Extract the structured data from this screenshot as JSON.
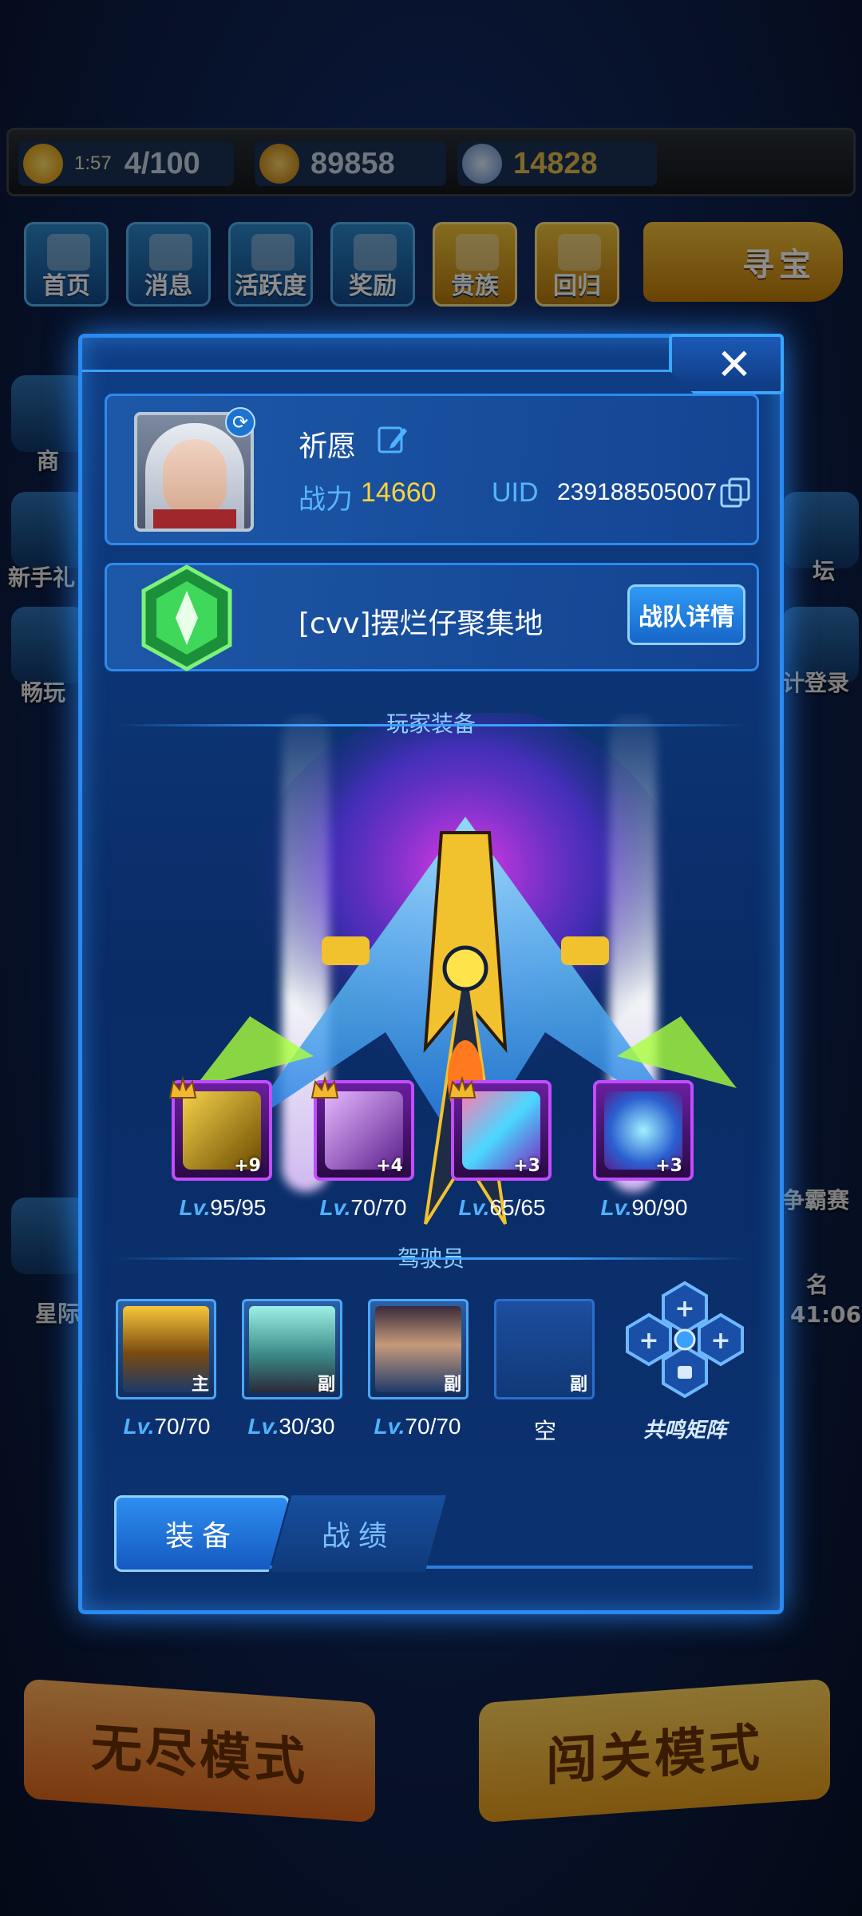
{
  "topbar": {
    "energy_time": "1:57",
    "energy": "4/100",
    "coins": "89858",
    "gems": "14828"
  },
  "nav": {
    "items": [
      "首页",
      "消息",
      "活跃度",
      "奖励",
      "贵族",
      "回归"
    ],
    "treasure": "寻宝"
  },
  "background": {
    "left_labels": [
      "商",
      "新手礼",
      "畅玩",
      "星际"
    ],
    "right_labels": [
      "坛",
      "计登录",
      "争霸赛",
      "名",
      "41:06"
    ],
    "mode_endless": "无尽模式",
    "mode_stage": "闯关模式"
  },
  "modal": {
    "close": "✕",
    "profile": {
      "name": "祈愿",
      "power_label": "战力",
      "power_value": "14660",
      "uid_label": "UID",
      "uid_value": "239188505007"
    },
    "team": {
      "name": "[cvv]摆烂仔聚集地",
      "detail_button": "战队详情"
    },
    "equipment_title": "玩家装备",
    "equipment": [
      {
        "plus": "+9",
        "level": "95/95"
      },
      {
        "plus": "+4",
        "level": "70/70"
      },
      {
        "plus": "+3",
        "level": "65/65"
      },
      {
        "plus": "+3",
        "level": "90/90"
      }
    ],
    "lv_prefix": "Lv.",
    "pilots_title": "驾驶员",
    "pilots": [
      {
        "role": "主",
        "level": "70/70"
      },
      {
        "role": "副",
        "level": "30/30"
      },
      {
        "role": "副",
        "level": "70/70"
      },
      {
        "role": "副",
        "level": "空"
      }
    ],
    "resonance_label": "共鸣矩阵",
    "tabs": [
      "装备",
      "战绩"
    ]
  }
}
